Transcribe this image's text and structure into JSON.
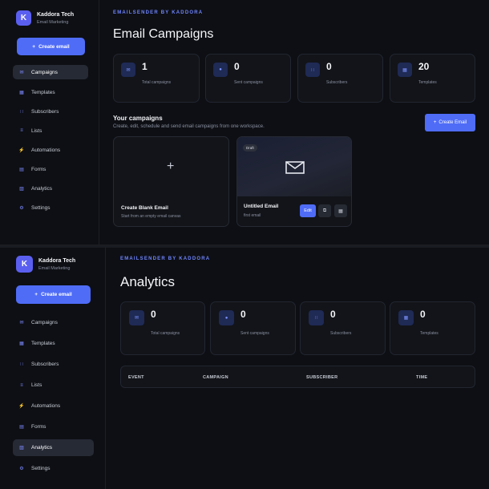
{
  "brand": {
    "name": "Kaddora Tech",
    "subtitle": "Email Marketing",
    "logo_letter": "K"
  },
  "sidebar": {
    "create_label": "Create email",
    "items": [
      {
        "label": "Campaigns",
        "icon": "mail-icon"
      },
      {
        "label": "Templates",
        "icon": "template-icon"
      },
      {
        "label": "Subscribers",
        "icon": "subscribers-icon"
      },
      {
        "label": "Lists",
        "icon": "list-icon"
      },
      {
        "label": "Automations",
        "icon": "bolt-icon"
      },
      {
        "label": "Forms",
        "icon": "form-icon"
      },
      {
        "label": "Analytics",
        "icon": "analytics-icon"
      },
      {
        "label": "Settings",
        "icon": "settings-icon"
      }
    ]
  },
  "eyebrow": "EMAILSENDER BY KADDORA",
  "campaigns_view": {
    "title": "Email Campaigns",
    "active_nav": "Campaigns",
    "stats": [
      {
        "value": "1",
        "label": "Total campaigns",
        "icon": "mail-icon"
      },
      {
        "value": "0",
        "label": "Sent campaigns",
        "icon": "send-icon"
      },
      {
        "value": "0",
        "label": "Subscribers",
        "icon": "subscribers-icon"
      },
      {
        "value": "20",
        "label": "Templates",
        "icon": "template-icon"
      }
    ],
    "section_title": "Your campaigns",
    "section_subtitle": "Create, edit, schedule and send email campaigns from one workspace.",
    "create_button": "Create Email",
    "blank_card": {
      "title": "Create Blank Email",
      "subtitle": "Start from an empty email canvas"
    },
    "campaign_card": {
      "badge": "Draft",
      "title": "Untitled Email",
      "subtitle": "first email",
      "edit_label": "Edit"
    }
  },
  "analytics_view": {
    "title": "Analytics",
    "active_nav": "Analytics",
    "stats": [
      {
        "value": "0",
        "label": "Total campaigns",
        "icon": "mail-icon"
      },
      {
        "value": "0",
        "label": "Sent campaigns",
        "icon": "send-icon"
      },
      {
        "value": "0",
        "label": "Subscribers",
        "icon": "subscribers-icon"
      },
      {
        "value": "0",
        "label": "Templates",
        "icon": "template-icon"
      }
    ],
    "table_columns": [
      "EVENT",
      "CAMPAIGN",
      "SUBSCRIBER",
      "TIME"
    ]
  },
  "colors": {
    "accent": "#4f6cf7",
    "background": "#0d0f14",
    "card": "#121419",
    "eyebrow": "#6f84ff"
  }
}
